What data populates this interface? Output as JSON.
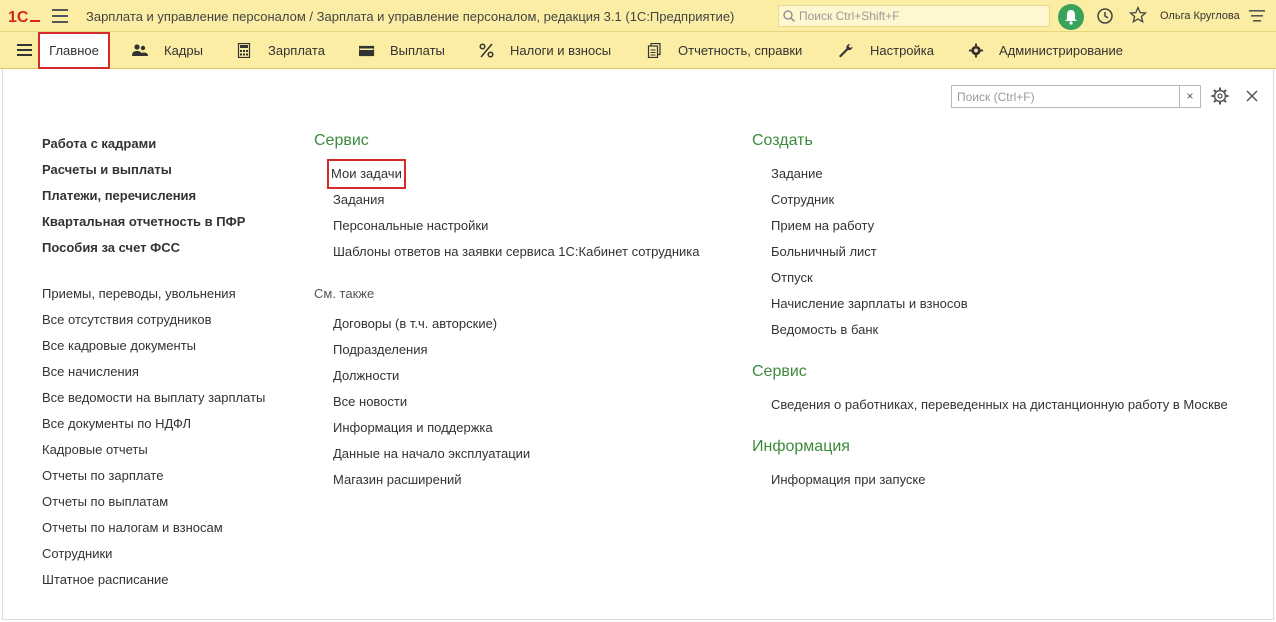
{
  "titlebar": {
    "logo": "1С",
    "title": "Зарплата и управление персоналом / Зарплата и управление персоналом, редакция 3.1  (1С:Предприятие)",
    "search_placeholder": "Поиск Ctrl+Shift+F",
    "user": "Ольга Круглова"
  },
  "sections": [
    {
      "label": "Главное",
      "icon": "home"
    },
    {
      "label": "Кадры",
      "icon": "people-icon"
    },
    {
      "label": "Зарплата",
      "icon": "calculator-icon"
    },
    {
      "label": "Выплаты",
      "icon": "wallet-icon"
    },
    {
      "label": "Налоги и взносы",
      "icon": "percent-icon"
    },
    {
      "label": "Отчетность, справки",
      "icon": "documents-icon"
    },
    {
      "label": "Настройка",
      "icon": "wrench-icon"
    },
    {
      "label": "Администрирование",
      "icon": "gear-icon"
    }
  ],
  "content": {
    "search_placeholder": "Поиск (Ctrl+F)",
    "search_clear": "×",
    "left_bold": [
      "Работа с кадрами",
      "Расчеты и выплаты",
      "Платежи, перечисления",
      "Квартальная отчетность в ПФР",
      "Пособия за счет ФСС"
    ],
    "left_links": [
      "Приемы, переводы, увольнения",
      "Все отсутствия сотрудников",
      "Все кадровые документы",
      "Все начисления",
      "Все ведомости на выплату зарплаты",
      "Все документы по НДФЛ",
      "Кадровые отчеты",
      "Отчеты по зарплате",
      "Отчеты по выплатам",
      "Отчеты по налогам и взносам",
      "Сотрудники",
      "Штатное расписание"
    ],
    "service": {
      "title": "Сервис",
      "items": [
        "Мои задачи",
        "Задания",
        "Персональные настройки",
        "Шаблоны ответов на заявки сервиса 1С:Кабинет сотрудника"
      ]
    },
    "see_also": {
      "title": "См. также",
      "items": [
        "Договоры (в т.ч. авторские)",
        "Подразделения",
        "Должности",
        "Все новости",
        "Информация и поддержка",
        "Данные на начало эксплуатации",
        "Магазин расширений"
      ]
    },
    "create": {
      "title": "Создать",
      "items": [
        "Задание",
        "Сотрудник",
        "Прием на работу",
        "Больничный лист",
        "Отпуск",
        "Начисление зарплаты и взносов",
        "Ведомость в банк"
      ]
    },
    "service2": {
      "title": "Сервис",
      "items": [
        "Сведения о работниках, переведенных на дистанционную работу в Москве"
      ]
    },
    "info": {
      "title": "Информация",
      "items": [
        "Информация при запуске"
      ]
    }
  },
  "colors": {
    "bar_bg": "#fbeda4",
    "highlight_border": "#d52b2b",
    "group_title": "#3d8a3d",
    "logo": "#d7261e"
  }
}
